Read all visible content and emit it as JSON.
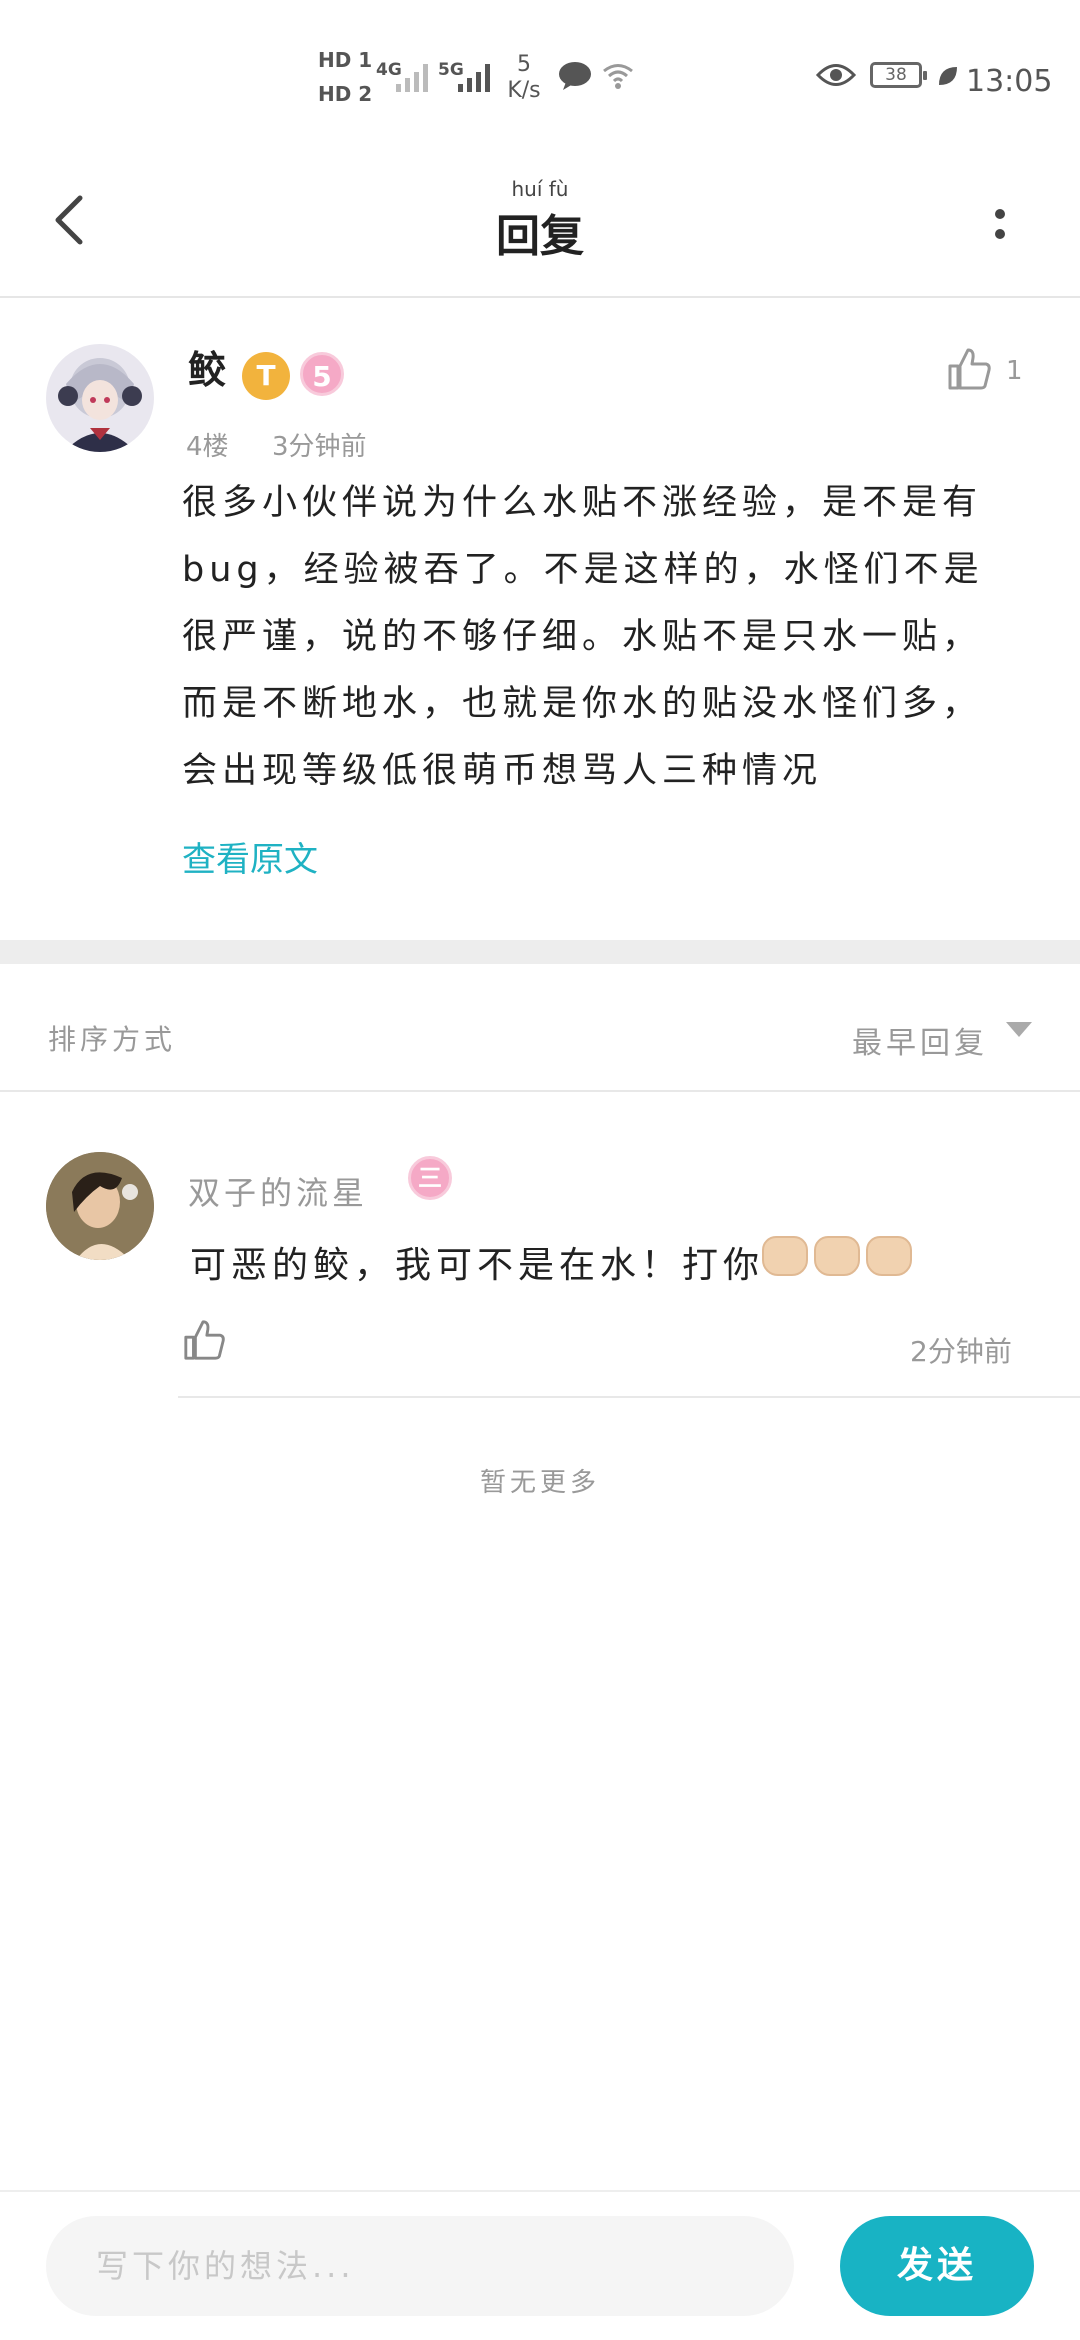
{
  "status_bar": {
    "hd1": "HD 1",
    "hd2": "HD 2",
    "net1": "4G",
    "net2": "5G",
    "speed_value": "5",
    "speed_unit": "K/s",
    "battery": "38",
    "time": "13:05"
  },
  "header": {
    "title_pinyin": "huí fù",
    "title": "回复"
  },
  "post": {
    "username": "鲛",
    "badge_level": "T",
    "badge_number": "5",
    "floor": "4楼",
    "time": "3分钟前",
    "like_count": "1",
    "body": "很多小伙伴说为什么水贴不涨经验，是不是有bug，经验被吞了。不是这样的，水怪们不是很严谨，说的不够仔细。水贴不是只水一贴，而是不断地水，也就是你水的贴没水怪们多，会出现等级低很萌币想骂人三种情况",
    "view_original": "查看原文"
  },
  "sort": {
    "label": "排序方式",
    "value": "最早回复"
  },
  "reply": {
    "username": "双子的流星",
    "badge_number": "三",
    "text": "可恶的鲛，我可不是在水！打你",
    "time": "2分钟前"
  },
  "footer_note": "暂无更多",
  "composer": {
    "placeholder": "写下你的想法...",
    "send_label": "发送"
  },
  "colors": {
    "accent": "#18b3c4",
    "muted": "#999999",
    "badge_gold": "#f2b33d",
    "badge_pink": "#f5a9c6"
  }
}
